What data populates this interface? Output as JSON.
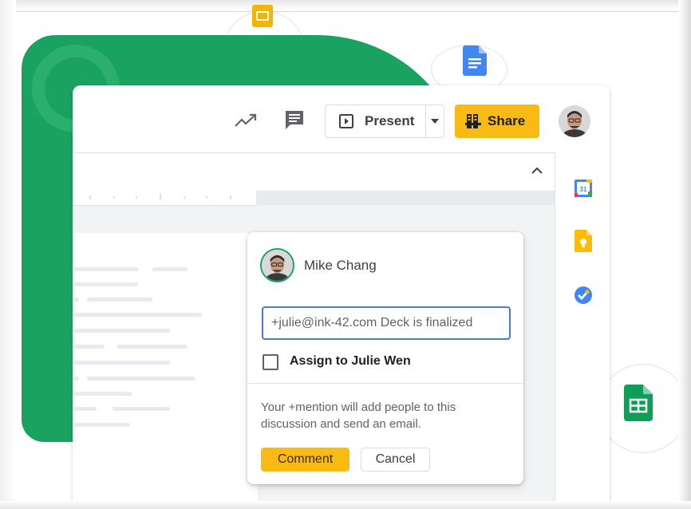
{
  "toolbar": {
    "present_label": "Present",
    "share_label": "Share",
    "icons": [
      "activity-trend-icon",
      "comment-icon",
      "present-icon",
      "chevron-down-icon",
      "share-people-icon"
    ]
  },
  "side_panel": {
    "icons": [
      "calendar-icon",
      "keep-icon",
      "tasks-icon"
    ],
    "calendar_number": "31"
  },
  "comment_card": {
    "author": "Mike Chang",
    "input_value": "+julie@ink-42.com Deck is finalized",
    "assign_label": "Assign to Julie Wen",
    "info_text": "Your +mention will add people to this discussion and send an email.",
    "comment_button": "Comment",
    "cancel_button": "Cancel"
  },
  "colors": {
    "brand_green": "#1aa260",
    "share_yellow": "#f9bb13",
    "focus_blue": "#4a7ac9",
    "docs_blue": "#4285f4",
    "sheets_green": "#0f9d58",
    "slides_yellow": "#f4b400"
  }
}
